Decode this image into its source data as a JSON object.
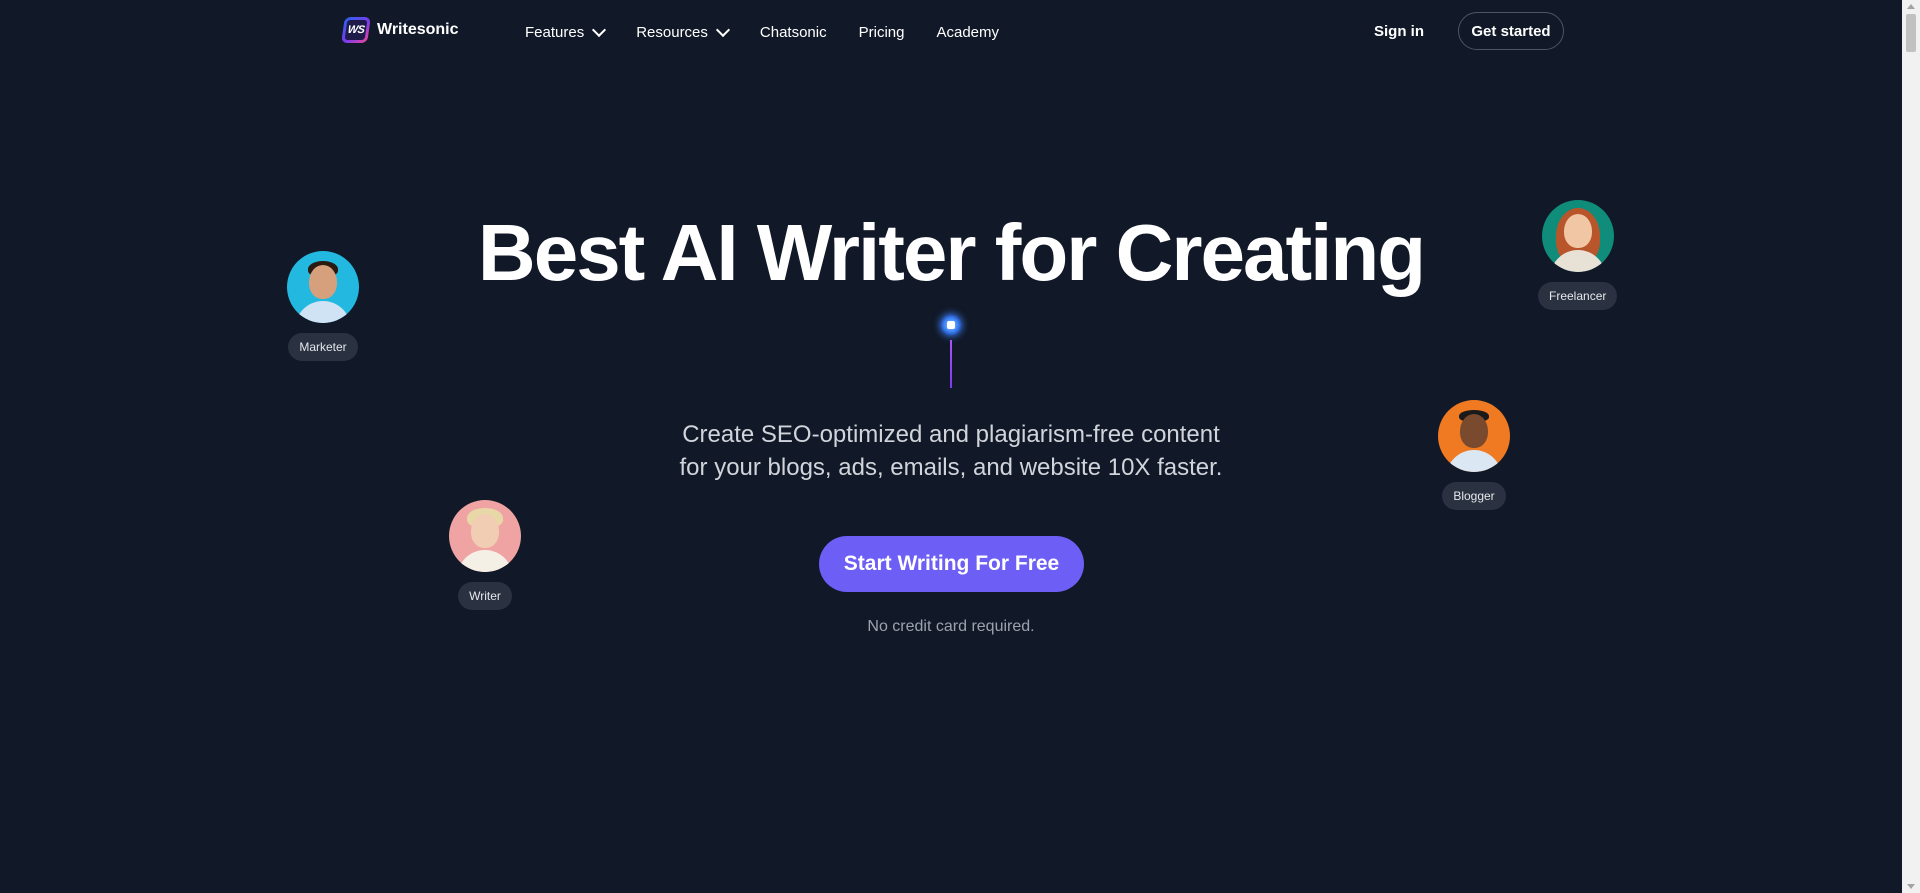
{
  "brand": {
    "name": "Writesonic",
    "logo_text": "WS"
  },
  "nav": {
    "items": [
      {
        "label": "Features",
        "dropdown": true
      },
      {
        "label": "Resources",
        "dropdown": true
      },
      {
        "label": "Chatsonic",
        "dropdown": false
      },
      {
        "label": "Pricing",
        "dropdown": false
      },
      {
        "label": "Academy",
        "dropdown": false
      }
    ],
    "sign_in": "Sign in",
    "get_started": "Get started"
  },
  "hero": {
    "headline": "Best AI Writer for Creating",
    "subtitle_line1": "Create SEO-optimized and plagiarism-free content",
    "subtitle_line2": "for your blogs, ads, emails, and website 10X faster.",
    "cta": "Start Writing For Free",
    "note": "No credit card required."
  },
  "personas": [
    {
      "label": "Marketer",
      "bg": "#22b8e0"
    },
    {
      "label": "Freelancer",
      "bg": "#0f8c7a"
    },
    {
      "label": "Blogger",
      "bg": "#f07a22"
    },
    {
      "label": "Writer",
      "bg": "#f0a3a3"
    }
  ],
  "colors": {
    "background": "#111827",
    "accent": "#6d5ef6"
  }
}
